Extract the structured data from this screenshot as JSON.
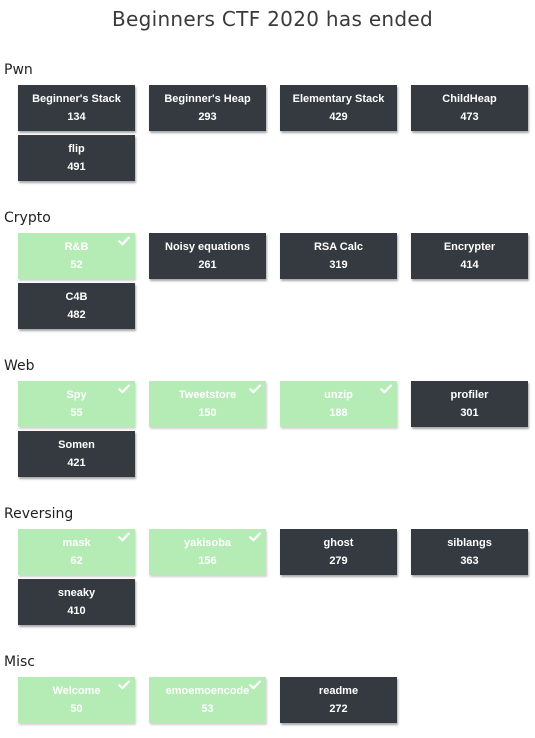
{
  "page": {
    "title": "Beginners CTF 2020 has ended"
  },
  "categories": [
    {
      "name": "Pwn",
      "challenges": [
        {
          "name": "Beginner's Stack",
          "points": "134",
          "solved": false
        },
        {
          "name": "Beginner's Heap",
          "points": "293",
          "solved": false
        },
        {
          "name": "Elementary Stack",
          "points": "429",
          "solved": false
        },
        {
          "name": "ChildHeap",
          "points": "473",
          "solved": false
        },
        {
          "name": "flip",
          "points": "491",
          "solved": false
        }
      ]
    },
    {
      "name": "Crypto",
      "challenges": [
        {
          "name": "R&B",
          "points": "52",
          "solved": true
        },
        {
          "name": "Noisy equations",
          "points": "261",
          "solved": false
        },
        {
          "name": "RSA Calc",
          "points": "319",
          "solved": false
        },
        {
          "name": "Encrypter",
          "points": "414",
          "solved": false
        },
        {
          "name": "C4B",
          "points": "482",
          "solved": false
        }
      ]
    },
    {
      "name": "Web",
      "challenges": [
        {
          "name": "Spy",
          "points": "55",
          "solved": true
        },
        {
          "name": "Tweetstore",
          "points": "150",
          "solved": true
        },
        {
          "name": "unzip",
          "points": "188",
          "solved": true
        },
        {
          "name": "profiler",
          "points": "301",
          "solved": false
        },
        {
          "name": "Somen",
          "points": "421",
          "solved": false
        }
      ]
    },
    {
      "name": "Reversing",
      "challenges": [
        {
          "name": "mask",
          "points": "62",
          "solved": true
        },
        {
          "name": "yakisoba",
          "points": "156",
          "solved": true
        },
        {
          "name": "ghost",
          "points": "279",
          "solved": false
        },
        {
          "name": "siblangs",
          "points": "363",
          "solved": false
        },
        {
          "name": "sneaky",
          "points": "410",
          "solved": false
        }
      ]
    },
    {
      "name": "Misc",
      "challenges": [
        {
          "name": "Welcome",
          "points": "50",
          "solved": true
        },
        {
          "name": "emoemoencode",
          "points": "53",
          "solved": true
        },
        {
          "name": "readme",
          "points": "272",
          "solved": false
        }
      ]
    }
  ],
  "colors": {
    "unsolved": "#343a40",
    "solved": "#b5ebb5"
  },
  "icons": {
    "solved": "check-icon"
  }
}
